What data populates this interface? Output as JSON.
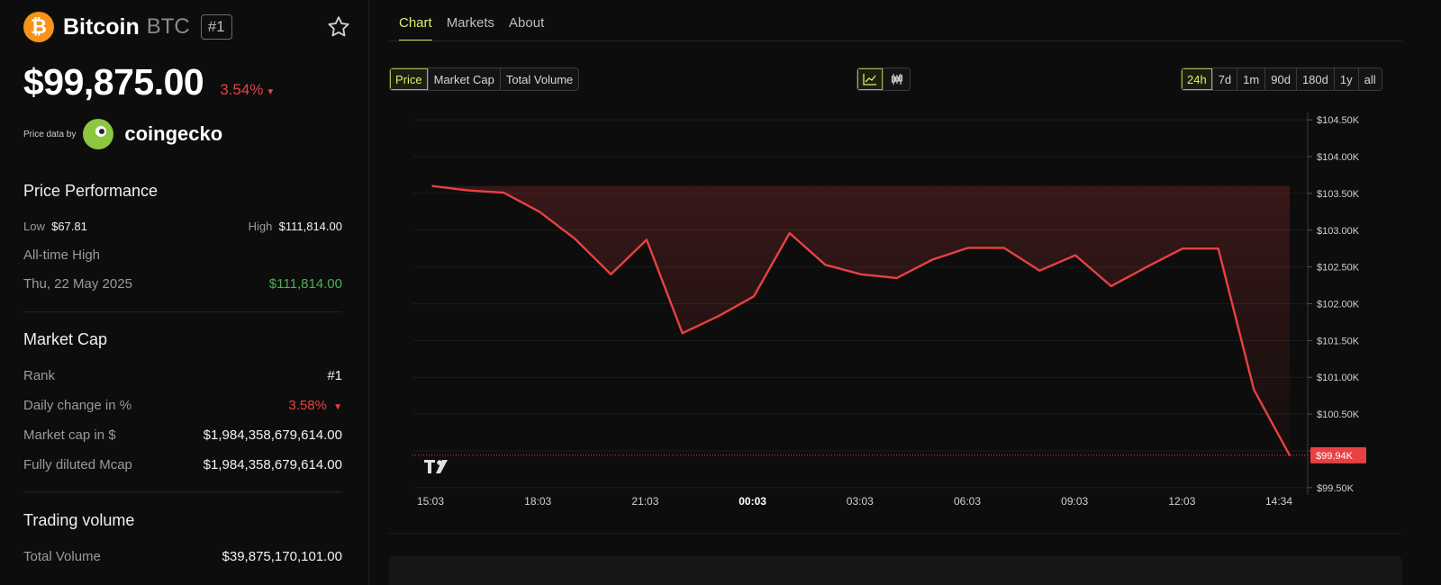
{
  "coin": {
    "logo_glyph": "₿",
    "name": "Bitcoin",
    "symbol": "BTC",
    "rank_badge": "#1",
    "price": "$99,875.00",
    "change": "3.54%",
    "change_arrow": "▼"
  },
  "price_data": {
    "label": "Price data by",
    "provider": "coingecko"
  },
  "performance": {
    "title": "Price Performance",
    "low_label": "Low",
    "low_value": "$67.81",
    "high_label": "High",
    "high_value": "$111,814.00",
    "ath_label": "All-time High",
    "ath_date": "Thu, 22 May 2025",
    "ath_value": "$111,814.00"
  },
  "market_cap": {
    "title": "Market Cap",
    "rows": [
      {
        "label": "Rank",
        "value": "#1"
      },
      {
        "label": "Daily change in %",
        "value": "3.58%",
        "arrow": "▼"
      },
      {
        "label": "Market cap in $",
        "value": "$1,984,358,679,614.00"
      },
      {
        "label": "Fully diluted Mcap",
        "value": "$1,984,358,679,614.00"
      }
    ]
  },
  "trading_volume": {
    "title": "Trading volume",
    "rows": [
      {
        "label": "Total Volume",
        "value": "$39,875,170,101.00"
      }
    ]
  },
  "tabs": [
    {
      "label": "Chart",
      "active": true
    },
    {
      "label": "Markets",
      "active": false
    },
    {
      "label": "About",
      "active": false
    }
  ],
  "metric_buttons": [
    {
      "label": "Price",
      "active": true
    },
    {
      "label": "Market Cap",
      "active": false
    },
    {
      "label": "Total Volume",
      "active": false
    }
  ],
  "chart_type_buttons": [
    {
      "icon": "line-chart-icon",
      "active": true
    },
    {
      "icon": "candlestick-icon",
      "active": false
    }
  ],
  "range_buttons": [
    {
      "label": "24h",
      "active": true
    },
    {
      "label": "7d",
      "active": false
    },
    {
      "label": "1m",
      "active": false
    },
    {
      "label": "90d",
      "active": false
    },
    {
      "label": "180d",
      "active": false
    },
    {
      "label": "1y",
      "active": false
    },
    {
      "label": "all",
      "active": false
    }
  ],
  "colors": {
    "accent": "#d9f26b",
    "down": "#e84142",
    "up": "#4caf50",
    "btc": "#f7931a"
  },
  "chart_data": {
    "type": "area",
    "x": [
      "15:03",
      "15:45",
      "16:30",
      "17:15",
      "18:03",
      "18:45",
      "19:30",
      "20:15",
      "21:03",
      "21:45",
      "22:30",
      "23:15",
      "00:03",
      "00:45",
      "01:30",
      "02:15",
      "03:03",
      "03:45",
      "04:30",
      "05:15",
      "06:03",
      "06:45",
      "07:30",
      "08:15",
      "09:03",
      "09:45",
      "10:30",
      "11:15",
      "12:03",
      "12:45",
      "13:30",
      "14:34"
    ],
    "values": [
      103600,
      103540,
      103510,
      103250,
      102880,
      102400,
      102870,
      101600,
      101830,
      102100,
      102960,
      102530,
      102400,
      102350,
      102600,
      102760,
      102760,
      102450,
      102660,
      102240,
      102500,
      102750,
      102750,
      100830,
      99940
    ],
    "xlabel": "",
    "ylabel": "",
    "ylim": [
      99400,
      104600
    ],
    "yticks": [
      99500,
      100000,
      100500,
      101000,
      101500,
      102000,
      102500,
      103000,
      103500,
      104000,
      104500
    ],
    "ytick_labels": [
      "$99.50K",
      "$100.00K",
      "$100.50K",
      "$101.00K",
      "$101.50K",
      "$102.00K",
      "$102.50K",
      "$103.00K",
      "$103.50K",
      "$104.00K",
      "$104.50K"
    ],
    "xtick_labels": [
      "15:03",
      "18:03",
      "21:03",
      "00:03",
      "03:03",
      "06:03",
      "09:03",
      "12:03",
      "14:34"
    ],
    "current_label": "$99.94K",
    "current_value": 99940,
    "grid": true,
    "watermark": "TV"
  }
}
